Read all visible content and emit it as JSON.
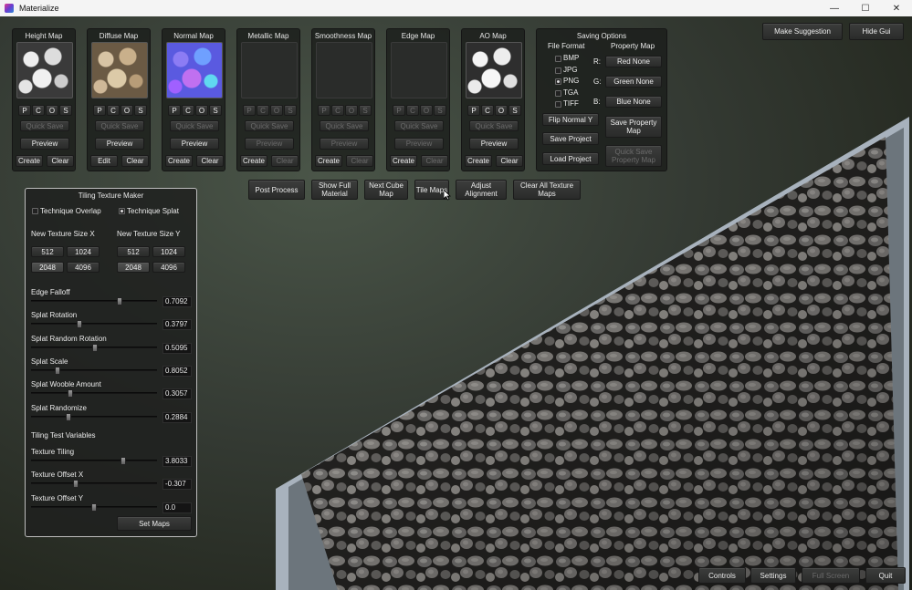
{
  "window": {
    "title": "Materialize",
    "minimize": "—",
    "maximize": "☐",
    "close": "✕"
  },
  "top_right": {
    "suggest": "Make Suggestion",
    "hide_gui": "Hide Gui"
  },
  "maps": [
    {
      "title": "Height Map",
      "thumb": "height",
      "p": "P",
      "c": "C",
      "o": "O",
      "s": "S",
      "quick_save": "Quick Save",
      "preview": "Preview",
      "left": "Create",
      "right": "Clear",
      "active": true
    },
    {
      "title": "Diffuse Map",
      "thumb": "diffuse",
      "p": "P",
      "c": "C",
      "o": "O",
      "s": "S",
      "quick_save": "Quick Save",
      "preview": "Preview",
      "left": "Edit",
      "right": "Clear",
      "active": true
    },
    {
      "title": "Normal Map",
      "thumb": "normal",
      "p": "P",
      "c": "C",
      "o": "O",
      "s": "S",
      "quick_save": "Quick Save",
      "preview": "Preview",
      "left": "Create",
      "right": "Clear",
      "active": true
    },
    {
      "title": "Metallic Map",
      "thumb": "",
      "p": "P",
      "c": "C",
      "o": "O",
      "s": "S",
      "quick_save": "Quick Save",
      "preview": "Preview",
      "left": "Create",
      "right": "Clear",
      "active": false
    },
    {
      "title": "Smoothness Map",
      "thumb": "",
      "p": "P",
      "c": "C",
      "o": "O",
      "s": "S",
      "quick_save": "Quick Save",
      "preview": "Preview",
      "left": "Create",
      "right": "Clear",
      "active": false
    },
    {
      "title": "Edge Map",
      "thumb": "",
      "p": "P",
      "c": "C",
      "o": "O",
      "s": "S",
      "quick_save": "Quick Save",
      "preview": "Preview",
      "left": "Create",
      "right": "Clear",
      "active": false
    },
    {
      "title": "AO Map",
      "thumb": "ao",
      "p": "P",
      "c": "C",
      "o": "O",
      "s": "S",
      "quick_save": "Quick Save",
      "preview": "Preview",
      "left": "Create",
      "right": "Clear",
      "active": true
    }
  ],
  "saving": {
    "title": "Saving Options",
    "file_format": "File Format",
    "property_map": "Property Map",
    "formats": [
      {
        "label": "BMP",
        "checked": false
      },
      {
        "label": "JPG",
        "checked": false
      },
      {
        "label": "PNG",
        "checked": true
      },
      {
        "label": "TGA",
        "checked": false
      },
      {
        "label": "TIFF",
        "checked": false
      }
    ],
    "r": "R:",
    "g": "G:",
    "b": "B:",
    "red": "Red None",
    "green": "Green None",
    "blue": "Blue None",
    "flip": "Flip Normal Y",
    "save_prop": "Save Property Map",
    "save_project": "Save Project",
    "quick_prop": "Quick Save Property Map",
    "load_project": "Load Project"
  },
  "toolbar": {
    "post": "Post Process",
    "show_full": "Show Full Material",
    "next_cube": "Next Cube Map",
    "tile_maps": "Tile Maps",
    "adjust": "Adjust Alignment",
    "clear_all": "Clear All Texture Maps"
  },
  "tiling": {
    "title": "Tiling Texture Maker",
    "tech_overlap": "Technique Overlap",
    "tech_splat": "Technique Splat",
    "size_x_label": "New Texture Size X",
    "size_y_label": "New Texture Size Y",
    "sizes": [
      "512",
      "1024",
      "2048",
      "4096"
    ],
    "selected_x": "2048",
    "selected_y": "2048",
    "sliders": [
      {
        "label": "Edge Falloff",
        "value": "0.7092",
        "pos": 0.7092
      },
      {
        "label": "Splat Rotation",
        "value": "0.3797",
        "pos": 0.3797
      },
      {
        "label": "Splat Random Rotation",
        "value": "0.5095",
        "pos": 0.5095
      },
      {
        "label": "Splat Scale",
        "value": "0.8052",
        "pos": 0.2
      },
      {
        "label": "Splat Wooble Amount",
        "value": "0.3057",
        "pos": 0.3057
      },
      {
        "label": "Splat Randomize",
        "value": "0.2884",
        "pos": 0.2884
      }
    ],
    "test_vars": "Tiling Test Variables",
    "test_sliders": [
      {
        "label": "Texture Tiling",
        "value": "3.8033",
        "pos": 0.74
      },
      {
        "label": "Texture Offset X",
        "value": "-0.307",
        "pos": 0.35
      },
      {
        "label": "Texture Offset Y",
        "value": "0.0",
        "pos": 0.5
      }
    ],
    "set_maps": "Set Maps"
  },
  "bottom": {
    "controls": "Controls",
    "settings": "Settings",
    "full_screen": "Full Screen",
    "quit": "Quit"
  },
  "colors": {
    "panel": "#1a1c1a",
    "accent": "#e8e8e8",
    "frame": "#a8b2bd"
  }
}
